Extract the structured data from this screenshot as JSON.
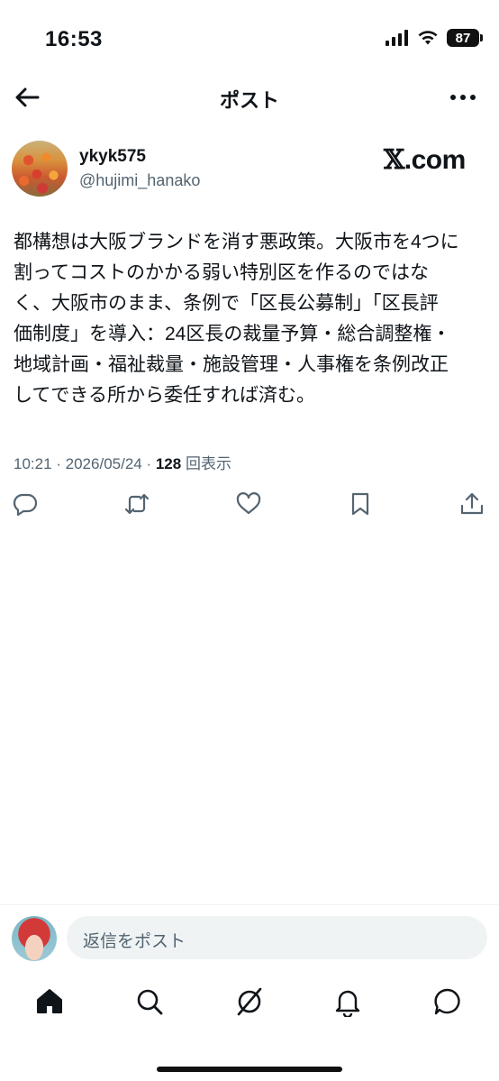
{
  "status_bar": {
    "time": "16:53",
    "battery_level": "87",
    "icons": [
      "signal-icon",
      "wifi-icon",
      "battery-icon"
    ]
  },
  "nav": {
    "title": "ポスト",
    "back_icon": "back-arrow-icon",
    "more_icon": "more-icon"
  },
  "post": {
    "display_name": "ykyk575",
    "handle": "@hujimi_hanako",
    "logo_text": ".com",
    "text_lines": [
      "都構想は大阪ブランドを消す悪政策。大阪市を4つに",
      "割ってコストのかかる弱い特別区を作るのではな",
      "く、大阪市のまま、条例で「区長公募制」「区長評",
      "価制度」を導入：24区長の裁量予算・総合調整権・",
      "地域計画・福祉裁量・施設管理・人事権を条例改正",
      "してできる所から委任すれば済む。"
    ],
    "timestamp": "10:21 · 2026/05/24 · ",
    "views_count": "128",
    "views_label": " 回表示",
    "actions": [
      "reply-icon",
      "repost-icon",
      "like-icon",
      "bookmark-icon",
      "share-icon"
    ]
  },
  "reply": {
    "placeholder": "返信をポスト"
  },
  "tabbar": {
    "items": [
      "home-icon",
      "search-icon",
      "grok-icon",
      "notifications-icon",
      "messages-icon"
    ]
  },
  "colors": {
    "text": "#0f1419",
    "secondary": "#536471",
    "input_bg": "#eff3f4"
  }
}
